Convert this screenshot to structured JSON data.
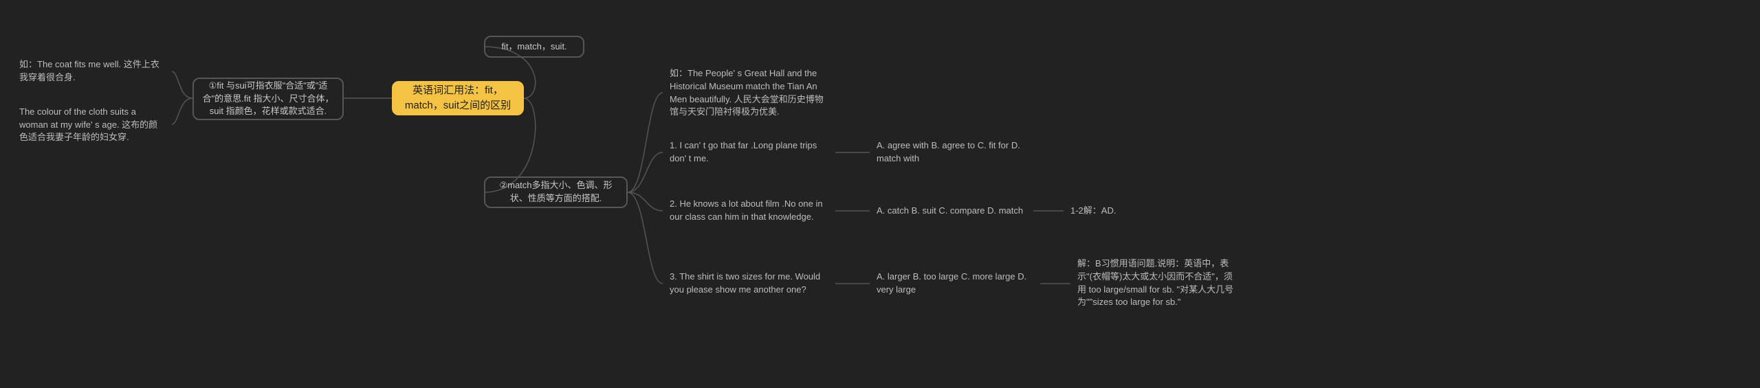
{
  "root": "英语词汇用法：fit，match，suit之间的区别",
  "left": {
    "explain1": "①fit 与sui可指衣服\"合适\"或\"适合\"的意思.fit 指大小、尺寸合体，suit 指颜色，花样或款式适合.",
    "ex1a": "如：The coat fits me well. 这件上衣我穿着很合身.",
    "ex1b": "The colour of the cloth suits a woman at my wife' s age. 这布的颜色适合我妻子年龄的妇女穿."
  },
  "right": {
    "top": "fit，match，suit.",
    "explain2": "②match多指大小、色调、形状、性质等方面的搭配.",
    "ex2": "如：The People' s Great Hall and the Historical Museum match the Tian An Men beautifully. 人民大会堂和历史博物馆与天安门陪衬得极为优美.",
    "q1": "1. I can' t go that far .Long plane trips don' t me.",
    "q1opts": "A. agree with B. agree to C. fit for D. match with",
    "q2": "2. He knows a lot about film .No one in our class can him in that knowledge.",
    "q2opts": "A. catch B. suit C. compare D. match",
    "ans12": "1-2解：AD.",
    "q3": "3. The shirt is two sizes for me. Would you please show me another one?",
    "q3opts": "A. larger B. too large C. more large D. very large",
    "ans3": "解：B习惯用语问题.说明：英语中，表示\"(衣帽等)太大或太小因而不合适\"，须用 too large/small for sb. \"对某人大几号为\"\"sizes too large for sb.\""
  }
}
